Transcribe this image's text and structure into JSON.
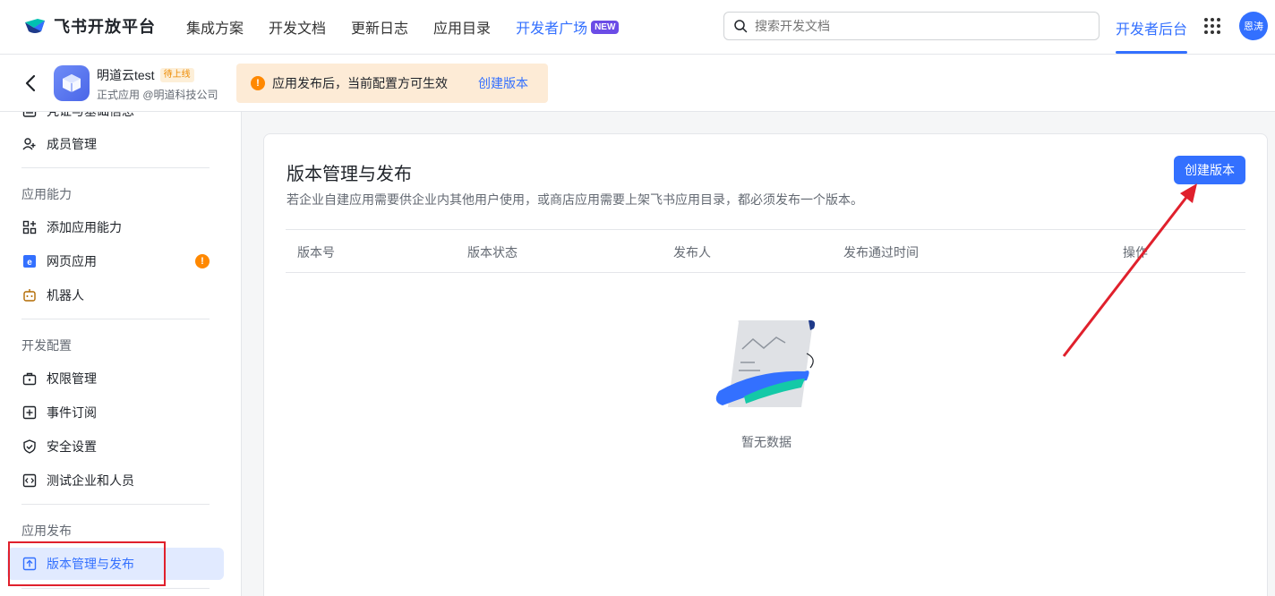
{
  "brand": {
    "name": "飞书开放平台"
  },
  "nav": {
    "links": [
      "集成方案",
      "开发文档",
      "更新日志",
      "应用目录"
    ],
    "square": "开发者广场",
    "new_badge": "NEW",
    "dev_backend": "开发者后台"
  },
  "search": {
    "placeholder": "搜索开发文档"
  },
  "user": {
    "avatar_text": "恩涛"
  },
  "app": {
    "name": "明道云test",
    "status_tag": "待上线",
    "subtitle": "正式应用 @明道科技公司"
  },
  "notice": {
    "icon_text": "!",
    "text": "应用发布后，当前配置方可生效",
    "link": "创建版本"
  },
  "sidebar": {
    "partial_item": "凭证与基础信息",
    "members": "成员管理",
    "section_capability": "应用能力",
    "add_capability": "添加应用能力",
    "web_app": "网页应用",
    "web_app_badge": "!",
    "bot": "机器人",
    "section_dev": "开发配置",
    "permissions": "权限管理",
    "events": "事件订阅",
    "security": "安全设置",
    "test_tenant": "测试企业和人员",
    "section_release": "应用发布",
    "version_release": "版本管理与发布"
  },
  "main": {
    "title": "版本管理与发布",
    "description": "若企业自建应用需要供企业内其他用户使用，或商店应用需要上架飞书应用目录，都必须发布一个版本。",
    "create_button": "创建版本",
    "columns": [
      "版本号",
      "版本状态",
      "发布人",
      "发布通过时间",
      "操作"
    ],
    "empty_text": "暂无数据"
  },
  "colors": {
    "primary": "#3370ff",
    "warning": "#ff8800",
    "notice_bg": "#fdebd6",
    "annotation_red": "#e0202c"
  }
}
